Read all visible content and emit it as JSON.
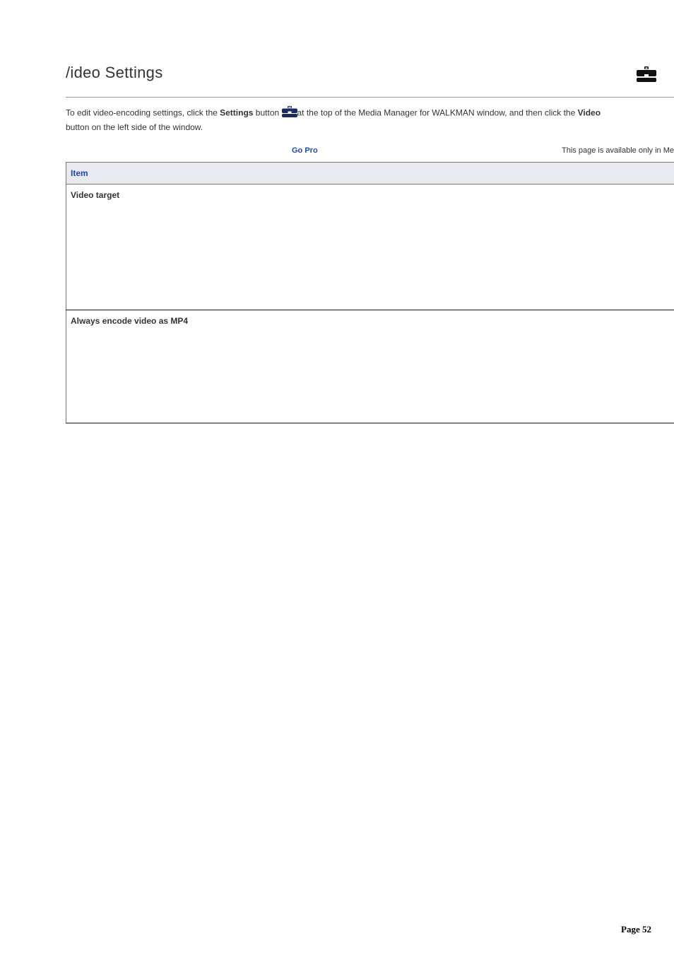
{
  "header": {
    "title": "/ideo Settings"
  },
  "intro": {
    "part1": "To edit video-encoding settings, click the ",
    "bold1": "Settings",
    "part2": " button ",
    "part3": "at the top of the Media Manager for WALKMAN window, and then click the ",
    "bold2": "Video",
    "part4": " button on the left side of the window."
  },
  "gopro": {
    "label": "Go Pro",
    "availability": "This page is available only in Me"
  },
  "table": {
    "header": "Item",
    "rows": [
      {
        "label": "Video target"
      },
      {
        "label": "Always encode video as MP4"
      }
    ]
  },
  "footer": {
    "prefix": "Page ",
    "number": "52"
  }
}
